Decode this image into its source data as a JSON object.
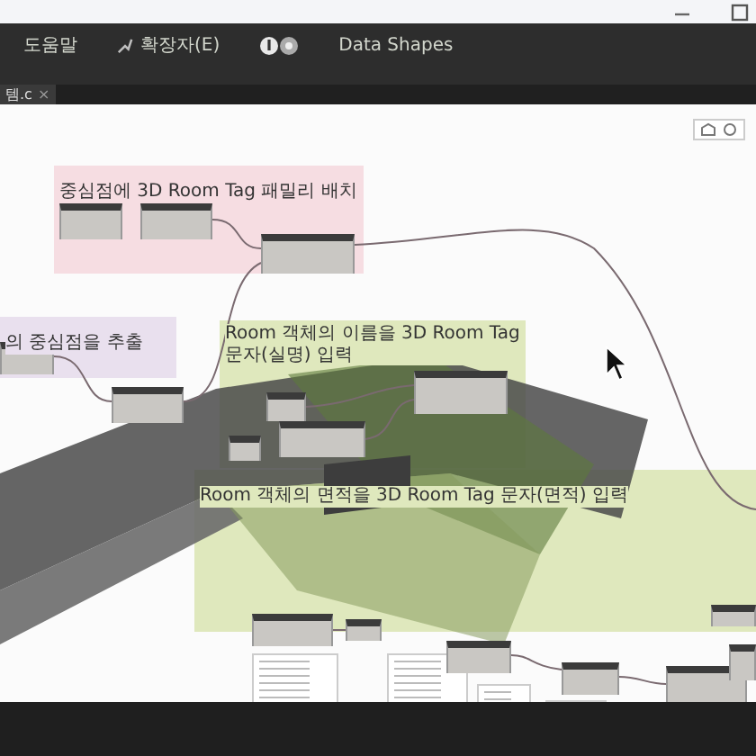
{
  "menu": [
    {
      "kind": "text",
      "label": "도움말"
    },
    {
      "kind": "icon-text",
      "label": "확장자(E)"
    },
    {
      "kind": "badges"
    },
    {
      "kind": "text",
      "label": "Data Shapes"
    }
  ],
  "tab": {
    "label": "템.c",
    "close": "×",
    "selected": true
  },
  "groups": [
    {
      "title": "중심점에 3D Room Tag 패밀리 배치",
      "color": "#f6dde2"
    },
    {
      "title": "의 중심점을 추출",
      "color": "#e9e0ee"
    },
    {
      "title": "Room 객체의 이름을 3D Room Tag 문자(실명) 입력",
      "color": "#dfe8bd"
    },
    {
      "title": "Room 객체의 면적을 3D Room Tag 문자(면적) 입력",
      "color": "#dfe8bd"
    }
  ]
}
